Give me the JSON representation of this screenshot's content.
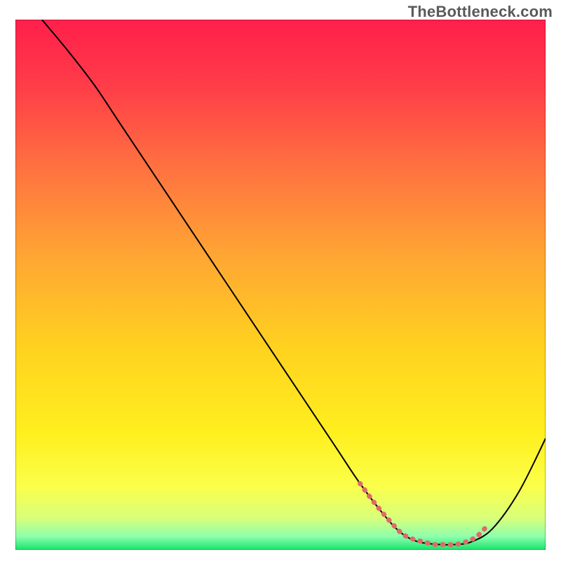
{
  "watermark": "TheBottleneck.com",
  "chart_data": {
    "type": "line",
    "title": "",
    "xlabel": "",
    "ylabel": "",
    "xlim": [
      0,
      100
    ],
    "ylim": [
      0,
      100
    ],
    "grid": false,
    "legend": false,
    "background": {
      "fill": "vertical-gradient",
      "stops": [
        {
          "offset": 0.0,
          "color": "#ff1f4b"
        },
        {
          "offset": 0.12,
          "color": "#ff3b49"
        },
        {
          "offset": 0.28,
          "color": "#ff7240"
        },
        {
          "offset": 0.45,
          "color": "#ffa733"
        },
        {
          "offset": 0.62,
          "color": "#ffd21f"
        },
        {
          "offset": 0.78,
          "color": "#ffef1f"
        },
        {
          "offset": 0.88,
          "color": "#fbff4a"
        },
        {
          "offset": 0.94,
          "color": "#d9ff7a"
        },
        {
          "offset": 0.975,
          "color": "#8dffad"
        },
        {
          "offset": 1.0,
          "color": "#19e56c"
        }
      ]
    },
    "series": [
      {
        "name": "curve",
        "stroke": "#000000",
        "stroke_width": 2,
        "x": [
          5,
          10,
          15,
          20,
          30,
          40,
          50,
          60,
          65,
          70,
          73,
          76,
          80,
          83,
          86,
          90,
          95,
          100
        ],
        "y": [
          100,
          94,
          87.5,
          80,
          65,
          50,
          35,
          20,
          12.5,
          6,
          3,
          1.5,
          1,
          1,
          1.5,
          4,
          11,
          21
        ]
      }
    ],
    "highlight": {
      "name": "valley-overlay",
      "stroke": "#e06a6a",
      "stroke_width": 7,
      "dash": [
        1,
        10
      ],
      "linecap": "round",
      "x": [
        65,
        68,
        71,
        73,
        75,
        77,
        79,
        81,
        83,
        85,
        87,
        89
      ],
      "y": [
        12.5,
        8.5,
        5,
        3,
        2,
        1.5,
        1,
        1,
        1,
        1.5,
        2.5,
        4.5
      ]
    }
  }
}
